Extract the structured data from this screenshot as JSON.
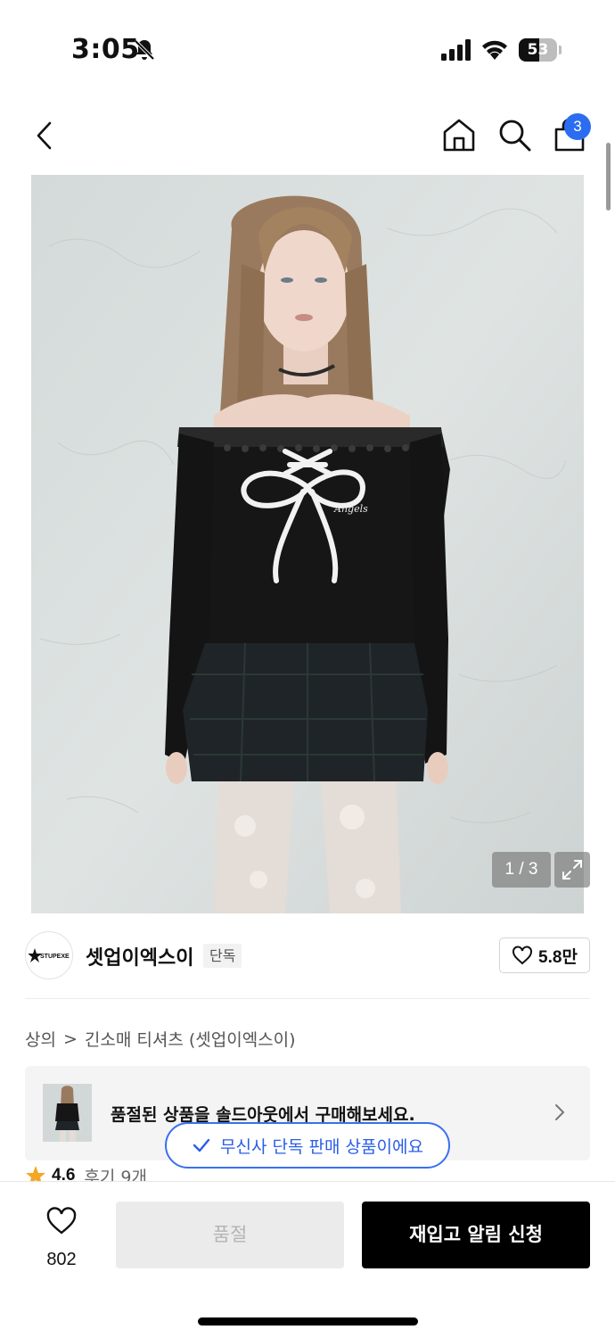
{
  "status_bar": {
    "time": "3:05",
    "battery_level": "53",
    "battery_fraction": 0.53,
    "icons": [
      "bell-off-icon",
      "cellular-signal-icon",
      "wifi-icon",
      "battery-icon"
    ]
  },
  "nav": {
    "icons": [
      "back-arrow-icon",
      "home-icon",
      "search-icon",
      "shopping-bag-icon"
    ],
    "cart_count": "3"
  },
  "product_image": {
    "page_indicator": "1 / 3",
    "expand_icon": "expand-icon"
  },
  "brand": {
    "logo_text": "STUPEXE",
    "name": "셋업이엑스이",
    "tag": "단독",
    "likes": "5.8만"
  },
  "breadcrumb": {
    "category": "상의",
    "separator": ">",
    "subcategory": "긴소매 티셔츠 (셋업이엑스이)"
  },
  "soldout_banner": {
    "text": "품절된 상품을 솔드아웃에서 구매해보세요."
  },
  "exclusive_toast": {
    "text": "무신사 단독 판매 상품이에요"
  },
  "rating": {
    "value": "4.6",
    "reviews": "후기 9개"
  },
  "bottom_bar": {
    "wish_count": "802",
    "soldout_label": "품절",
    "restock_label": "재입고 알림 신청"
  },
  "colors": {
    "accent_blue": "#2b6cf0",
    "toast_blue": "#2a5ee8",
    "star": "#f5a623",
    "primary_button": "#000000",
    "disabled_button": "#ebebeb"
  }
}
